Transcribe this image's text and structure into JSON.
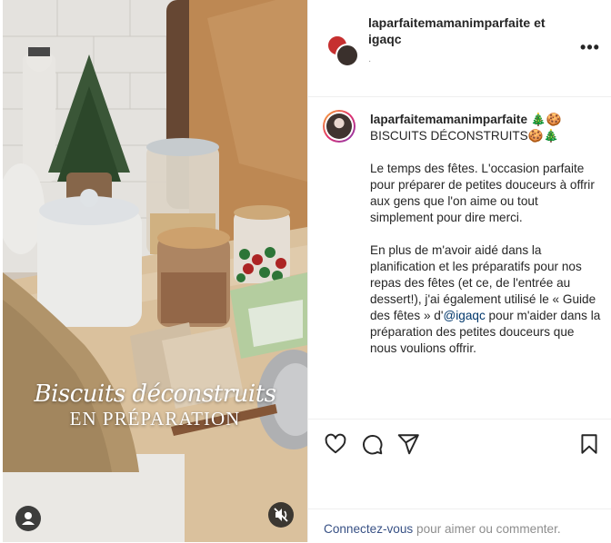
{
  "header": {
    "names": "laparfaitemamanimparfaite et igaqc",
    "subtitle": "·",
    "more_icon": "more-horizontal-icon"
  },
  "media": {
    "title_line1": "Biscuits déconstruits",
    "title_line2": "EN PRÉPARATION",
    "user_icon": "user-tag-icon",
    "mute_icon": "speaker-muted-icon"
  },
  "caption": {
    "username": "laparfaitemamanimparfaite",
    "line1_emoji": "🎄🍪",
    "title": "BISCUITS DÉCONSTRUITS",
    "title_emoji": "🍪🎄",
    "paragraph1": "Le temps des fêtes. L'occasion parfaite pour préparer de petites douceurs à offrir aux gens que l'on aime ou tout simplement pour dire merci.",
    "paragraph2_a": "En plus de m'avoir aidé dans la planification et les préparatifs pour nos repas des fêtes (et ce, de l'entrée au dessert!), j'ai également utilisé le « Guide des fêtes » d'",
    "mention": "@igaqc",
    "paragraph2_b": " pour m'aider dans la préparation des petites douceurs que nous voulions offrir."
  },
  "actions": {
    "like_icon": "heart-icon",
    "comment_icon": "comment-bubble-icon",
    "share_icon": "paper-plane-icon",
    "save_icon": "bookmark-icon"
  },
  "footer": {
    "login_link": "Connectez-vous",
    "login_rest": " pour aimer ou commenter."
  },
  "colors": {
    "text": "#262626",
    "muted": "#8e8e8e",
    "link": "#385185",
    "mention": "#00376b",
    "border": "#efefef"
  }
}
